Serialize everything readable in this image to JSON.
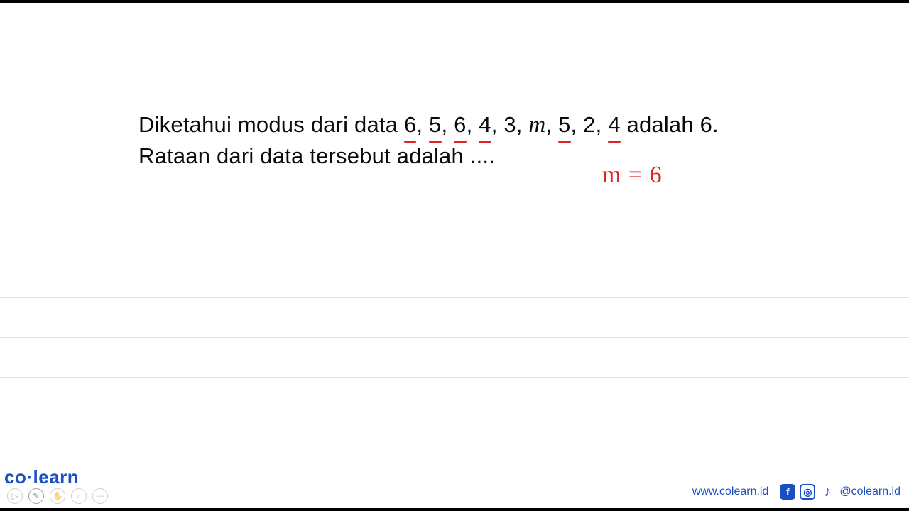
{
  "problem": {
    "prefix": "Diketahui modus dari data ",
    "d1": "6",
    "c1": ", ",
    "d2": "5",
    "c2": ", ",
    "d3": "6",
    "c3": ", ",
    "d4": "4",
    "c4": ", 3, ",
    "m": "m",
    "c5": ", ",
    "d5": "5",
    "c6": ", 2, ",
    "d6": "4",
    "suffix": " adalah 6.",
    "line2": "Rataan dari data tersebut adalah  ...."
  },
  "annotation": {
    "text": "m = 6"
  },
  "footer": {
    "brand_co": "co",
    "brand_learn": "learn",
    "url": "www.colearn.id",
    "handle": "@colearn.id"
  },
  "tools": {
    "play": "▷",
    "pen": "✎",
    "hand": "✋",
    "zoom": "⌕",
    "more": "⋯"
  },
  "social": {
    "fb": "f",
    "ig": "◎",
    "tt": "♪"
  }
}
